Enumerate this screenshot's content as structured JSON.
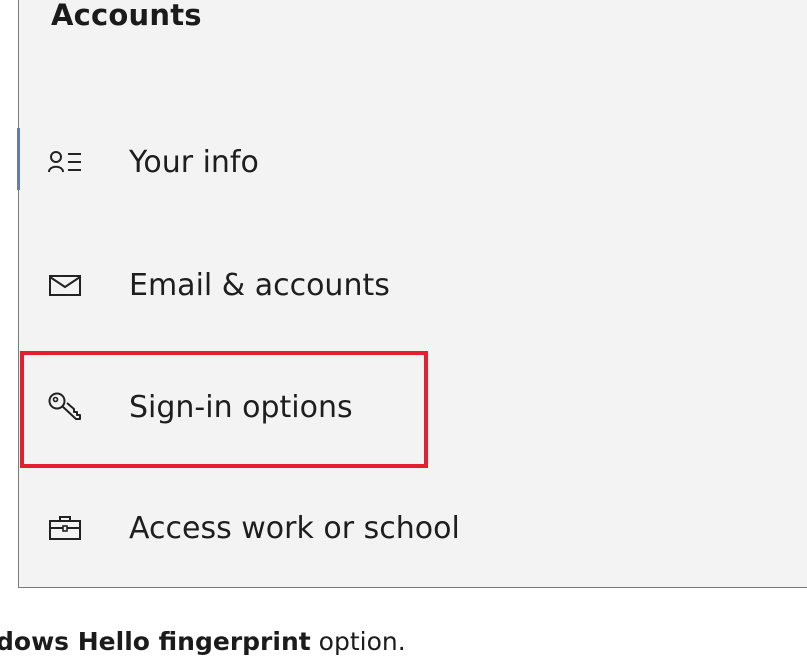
{
  "panel": {
    "title": "Accounts",
    "nav_items": [
      {
        "label": "Your info",
        "icon": "person-list-icon",
        "selected": true
      },
      {
        "label": "Email & accounts",
        "icon": "mail-icon",
        "selected": false
      },
      {
        "label": "Sign-in options",
        "icon": "key-icon",
        "selected": false
      },
      {
        "label": "Access work or school",
        "icon": "briefcase-icon",
        "selected": false
      }
    ]
  },
  "highlight": {
    "target": "Sign-in options",
    "color": "#e3202f"
  },
  "caption": {
    "prefix": "dows Hello fingerprint",
    "suffix": " option."
  },
  "colors": {
    "panel_background": "#f3f3f3",
    "accent": "#5b7fb8",
    "highlight": "#e3202f"
  }
}
